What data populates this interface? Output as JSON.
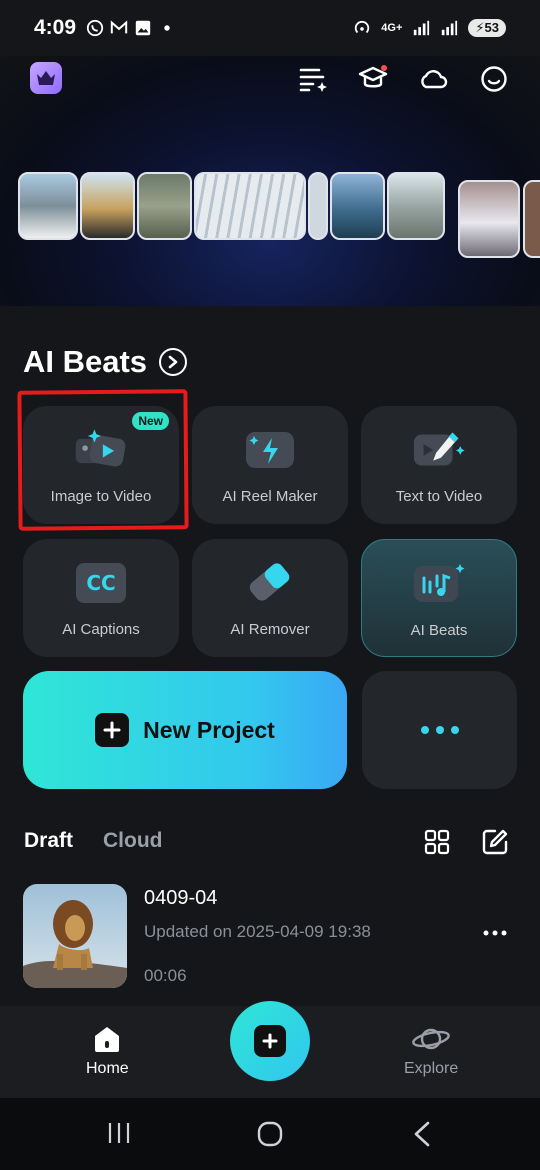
{
  "status_bar": {
    "time": "4:09",
    "network": "4G+",
    "battery": "53"
  },
  "section": {
    "title": "AI Beats"
  },
  "tools": [
    {
      "label": "Image to Video",
      "badge": "New"
    },
    {
      "label": "AI Reel Maker"
    },
    {
      "label": "Text to Video"
    },
    {
      "label": "AI Captions",
      "icon_text": "CC"
    },
    {
      "label": "AI Remover"
    },
    {
      "label": "AI Beats"
    }
  ],
  "new_project": {
    "label": "New Project"
  },
  "drafts": {
    "tabs": [
      "Draft",
      "Cloud"
    ],
    "items": [
      {
        "name": "0409-04",
        "updated": "Updated on 2025-04-09 19:38",
        "duration": "00:06"
      }
    ]
  },
  "bottom_nav": {
    "home": "Home",
    "explore": "Explore"
  },
  "colors": {
    "accent": "#2fe6d6",
    "card": "#23262b",
    "background": "#141619",
    "highlight_frame": "#e61c1c"
  }
}
